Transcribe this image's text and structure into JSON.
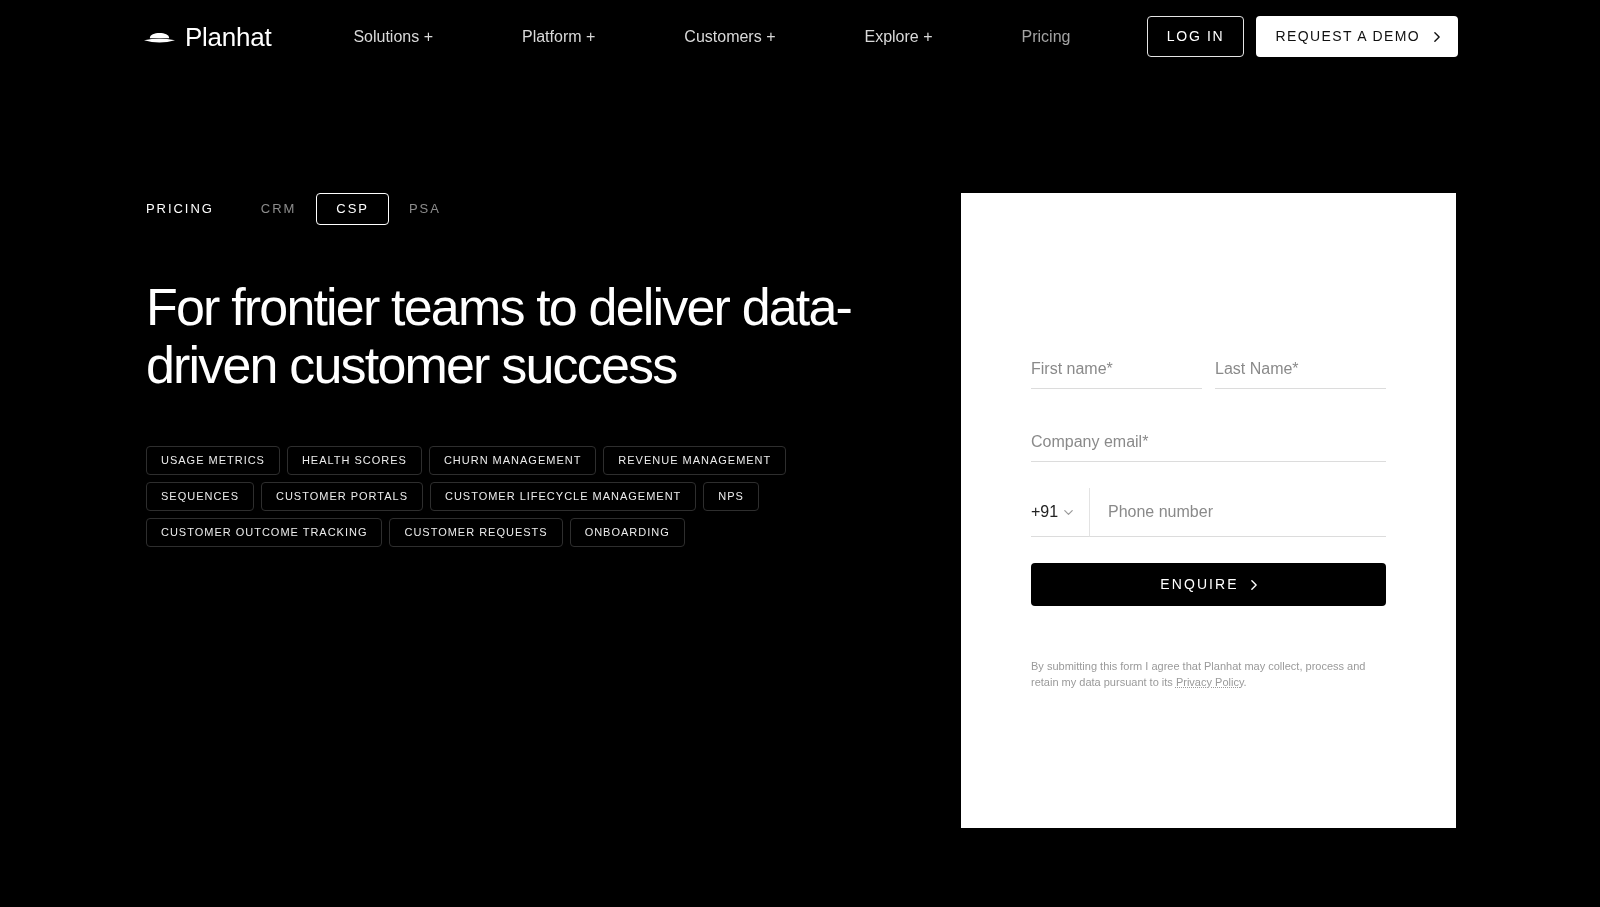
{
  "header": {
    "logo": "Planhat",
    "nav": [
      {
        "label": "Solutions +",
        "selected": false
      },
      {
        "label": "Platform +",
        "selected": false
      },
      {
        "label": "Customers +",
        "selected": false
      },
      {
        "label": "Explore +",
        "selected": false
      },
      {
        "label": "Pricing",
        "selected": true
      }
    ],
    "buttons": [
      {
        "label": "LOG IN",
        "kind": "outline"
      },
      {
        "label": "REQUEST A DEMO",
        "kind": "solid"
      }
    ]
  },
  "hero": {
    "label": "PRICING",
    "tabs": [
      {
        "label": "CRM",
        "selected": false
      },
      {
        "label": "CSP",
        "selected": true
      },
      {
        "label": "PSA",
        "selected": false
      }
    ],
    "title": "For frontier teams to deliver data-driven customer success",
    "tags": [
      "USAGE METRICS",
      "HEALTH SCORES",
      "CHURN MANAGEMENT",
      "REVENUE MANAGEMENT",
      "SEQUENCES",
      "CUSTOMER PORTALS",
      "CUSTOMER LIFECYCLE MANAGEMENT",
      "NPS",
      "CUSTOMER OUTCOME TRACKING",
      "CUSTOMER REQUESTS",
      "ONBOARDING"
    ]
  },
  "form": {
    "name_fields": [
      {
        "placeholder": "First name*"
      },
      {
        "placeholder": "Last Name*"
      }
    ],
    "email": {
      "placeholder": "Company email*"
    },
    "phone": {
      "country_code": "+91",
      "placeholder": "Phone number"
    },
    "submit": "ENQUIRE",
    "consent": {
      "text": "By submitting this form I agree that Planhat may collect, process and retain my data pursuant to its",
      "link": "Privacy Policy",
      "end": "."
    }
  }
}
